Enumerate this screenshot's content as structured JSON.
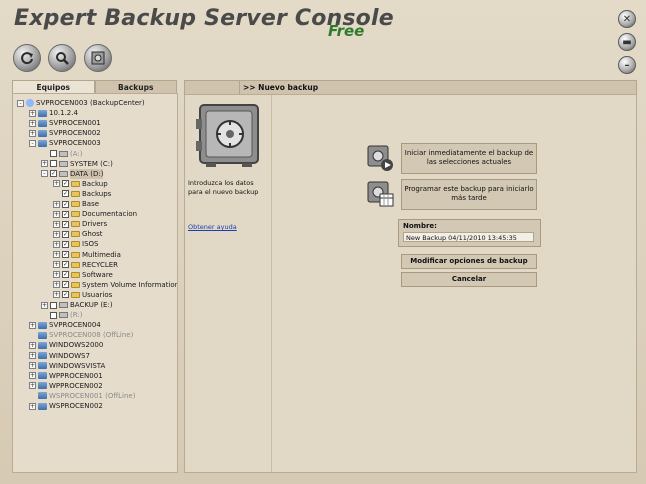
{
  "app": {
    "title": "Expert Backup Server Console",
    "edition": "Free"
  },
  "toolbar": {
    "icons": [
      "refresh-icon",
      "search-icon",
      "safe-icon"
    ]
  },
  "window_controls": [
    "close-icon",
    "minimize-to-tray-icon",
    "minimize-icon"
  ],
  "tabs": [
    {
      "label": "Equipos"
    },
    {
      "label": "Backups"
    }
  ],
  "tree": {
    "items": [
      {
        "label": "SVPROCEN003 (BackupCenter)",
        "level": 0,
        "icon": "network-icon",
        "exp": "-",
        "chk": null,
        "offline": false
      },
      {
        "label": "10.1.2.4",
        "level": 1,
        "icon": "computer-icon",
        "exp": "+",
        "chk": null,
        "offline": false
      },
      {
        "label": "SVPROCEN001",
        "level": 1,
        "icon": "computer-icon",
        "exp": "+",
        "chk": null,
        "offline": false
      },
      {
        "label": "SVPROCEN002",
        "level": 1,
        "icon": "computer-icon",
        "exp": "+",
        "chk": null,
        "offline": false
      },
      {
        "label": "SVPROCEN003",
        "level": 1,
        "icon": "computer-icon",
        "exp": "-",
        "chk": null,
        "offline": false
      },
      {
        "label": "(A:)",
        "level": 2,
        "icon": "drive-icon",
        "exp": "",
        "chk": "",
        "offline": true
      },
      {
        "label": "SYSTEM (C:)",
        "level": 2,
        "icon": "drive-icon",
        "exp": "+",
        "chk": "",
        "offline": false
      },
      {
        "label": "DATA (D:)",
        "level": 2,
        "icon": "drive-icon",
        "exp": "-",
        "chk": "✓",
        "offline": false,
        "selected": true
      },
      {
        "label": "Backup",
        "level": 3,
        "icon": "folder-icon",
        "exp": "+",
        "chk": "✓",
        "offline": false
      },
      {
        "label": "Backups",
        "level": 3,
        "icon": "folder-icon",
        "exp": "",
        "chk": "✓",
        "offline": false
      },
      {
        "label": "Base",
        "level": 3,
        "icon": "folder-icon",
        "exp": "+",
        "chk": "✓",
        "offline": false
      },
      {
        "label": "Documentacion",
        "level": 3,
        "icon": "folder-icon",
        "exp": "+",
        "chk": "✓",
        "offline": false
      },
      {
        "label": "Drivers",
        "level": 3,
        "icon": "folder-icon",
        "exp": "+",
        "chk": "✓",
        "offline": false
      },
      {
        "label": "Ghost",
        "level": 3,
        "icon": "folder-icon",
        "exp": "+",
        "chk": "✓",
        "offline": false
      },
      {
        "label": "ISOS",
        "level": 3,
        "icon": "folder-icon",
        "exp": "+",
        "chk": "✓",
        "offline": false
      },
      {
        "label": "Multimedia",
        "level": 3,
        "icon": "folder-icon",
        "exp": "+",
        "chk": "✓",
        "offline": false
      },
      {
        "label": "RECYCLER",
        "level": 3,
        "icon": "folder-icon",
        "exp": "+",
        "chk": "✓",
        "offline": false
      },
      {
        "label": "Software",
        "level": 3,
        "icon": "folder-icon",
        "exp": "+",
        "chk": "✓",
        "offline": false
      },
      {
        "label": "System Volume Information",
        "level": 3,
        "icon": "folder-icon",
        "exp": "+",
        "chk": "✓",
        "offline": false
      },
      {
        "label": "Usuarios",
        "level": 3,
        "icon": "folder-icon",
        "exp": "+",
        "chk": "✓",
        "offline": false
      },
      {
        "label": "BACKUP (E:)",
        "level": 2,
        "icon": "drive-icon",
        "exp": "+",
        "chk": "",
        "offline": false
      },
      {
        "label": "(R:)",
        "level": 2,
        "icon": "drive-icon",
        "exp": "",
        "chk": "",
        "offline": true
      },
      {
        "label": "SVPROCEN004",
        "level": 1,
        "icon": "computer-icon",
        "exp": "+",
        "chk": null,
        "offline": false
      },
      {
        "label": "SVPROCEN008 (OffLine)",
        "level": 1,
        "icon": "computer-icon",
        "exp": "",
        "chk": null,
        "offline": true
      },
      {
        "label": "WINDOWS2000",
        "level": 1,
        "icon": "computer-icon",
        "exp": "+",
        "chk": null,
        "offline": false
      },
      {
        "label": "WINDOWS7",
        "level": 1,
        "icon": "computer-icon",
        "exp": "+",
        "chk": null,
        "offline": false
      },
      {
        "label": "WINDOWSVISTA",
        "level": 1,
        "icon": "computer-icon",
        "exp": "+",
        "chk": null,
        "offline": false
      },
      {
        "label": "WPPROCEN001",
        "level": 1,
        "icon": "computer-icon",
        "exp": "+",
        "chk": null,
        "offline": false
      },
      {
        "label": "WPPROCEN002",
        "level": 1,
        "icon": "computer-icon",
        "exp": "+",
        "chk": null,
        "offline": false
      },
      {
        "label": "WSPROCEN001 (OffLine)",
        "level": 1,
        "icon": "computer-icon",
        "exp": "",
        "chk": null,
        "offline": true
      },
      {
        "label": "WSPROCEN002",
        "level": 1,
        "icon": "computer-icon",
        "exp": "+",
        "chk": null,
        "offline": false
      }
    ]
  },
  "right": {
    "header": ">> Nuevo backup",
    "intro": "Introduzca los datos para el nuevo backup",
    "help": "Obtener ayuda",
    "start_now": "Iniciar inmediatamente el backup de las selecciones actuales",
    "schedule": "Programar este backup para iniciarlo más tarde",
    "name_label": "Nombre:",
    "name_value": "New Backup 04/11/2010 13:45:35",
    "modify": "Modificar opciones de backup",
    "cancel": "Cancelar"
  }
}
